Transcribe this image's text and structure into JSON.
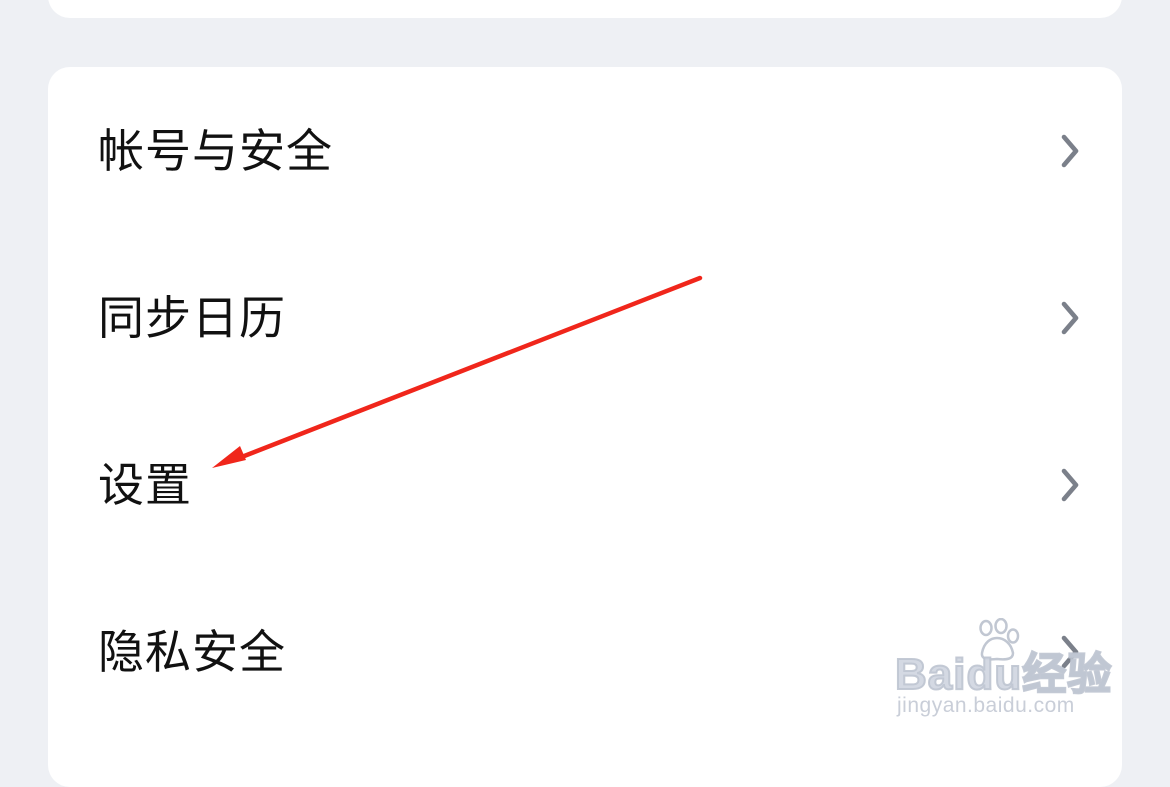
{
  "settings_list": {
    "items": [
      {
        "id": "account-security",
        "label": "帐号与安全"
      },
      {
        "id": "sync-calendar",
        "label": "同步日历"
      },
      {
        "id": "settings",
        "label": "设置"
      },
      {
        "id": "privacy-security",
        "label": "隐私安全"
      }
    ]
  },
  "annotation": {
    "color": "#f0261b"
  },
  "watermark": {
    "logo_text": "Baidu经验",
    "url_text": "jingyan.baidu.com"
  }
}
